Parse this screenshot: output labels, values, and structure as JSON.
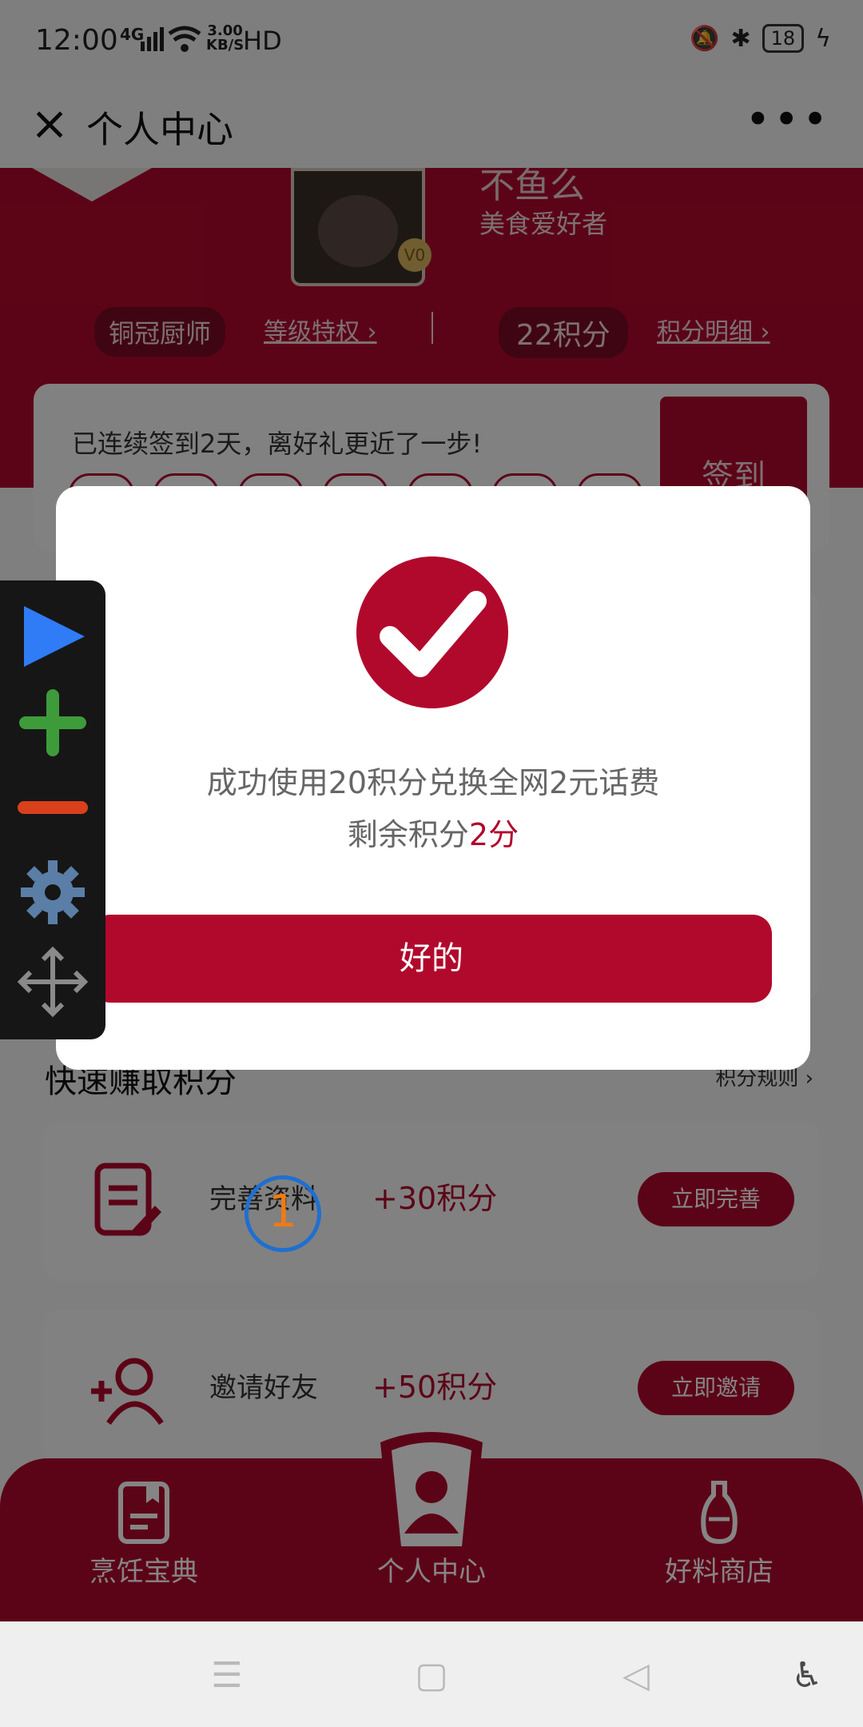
{
  "status_bar": {
    "time": "12:00",
    "network": "4G",
    "speed_top": "3.00",
    "speed_bottom": "KB/S",
    "hd": "HD",
    "battery": "18"
  },
  "header": {
    "title": "个人中心",
    "close_icon": "close-icon",
    "more_icon": "more-icon"
  },
  "profile": {
    "nickname": "不鱼么",
    "subtitle": "美食爱好者",
    "vip_badge": "V0",
    "level_badge": "铜冠厨师",
    "level_link": "等级特权",
    "points_badge": "22积分",
    "points_link": "积分明细"
  },
  "signin": {
    "message": "已连续签到2天，离好礼更近了一步!",
    "button": "签到"
  },
  "earn_section": {
    "title": "快速赚取积分",
    "rules_link": "积分规则",
    "tasks": [
      {
        "title": "完善资料",
        "points": "+30积分",
        "button": "立即完善",
        "icon": "edit-document-icon"
      },
      {
        "title": "邀请好友",
        "points": "+50积分",
        "button": "立即邀请",
        "icon": "add-user-icon"
      }
    ]
  },
  "modal": {
    "line1": "成功使用20积分兑换全网2元话费",
    "line2_prefix": "剩余积分",
    "line2_value": "2分",
    "ok_button": "好的",
    "icon": "checkmark-icon"
  },
  "tool_panel": {
    "items": [
      "play-icon",
      "plus-icon",
      "minus-icon",
      "gear-icon",
      "move-icon"
    ]
  },
  "tap_indicator": {
    "number": "1"
  },
  "bottom_nav": {
    "items": [
      {
        "label": "烹饪宝典",
        "icon": "cookbook-icon"
      },
      {
        "label": "个人中心",
        "icon": "user-icon"
      },
      {
        "label": "好料商店",
        "icon": "bottle-icon"
      }
    ]
  },
  "colors": {
    "brand": "#b1092c",
    "overlay": "#000000",
    "tool_play": "#2f7cf6",
    "tool_plus": "#3e9b3a",
    "tool_minus": "#d9401b",
    "tool_gear": "#5b7ea6"
  }
}
